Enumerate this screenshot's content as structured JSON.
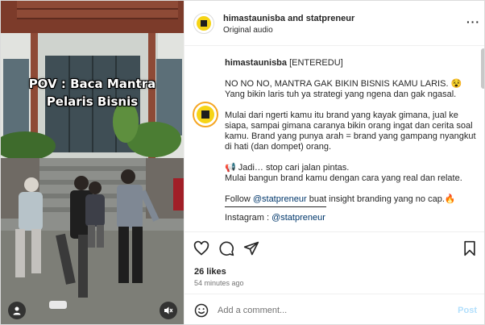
{
  "header": {
    "account_primary": "himastaunisba",
    "joiner": " and ",
    "account_secondary": "statpreneur",
    "audio": "Original audio",
    "more_icon": "more-horizontal-icon"
  },
  "media": {
    "caption_line1": "POV : Baca Mantra",
    "caption_line2": "Pelaris Bisnis",
    "user_icon": "user-tag-icon",
    "mute_icon": "muted-speaker-icon"
  },
  "post": {
    "author": "himastaunisba",
    "tag": "[ENTEREDU]",
    "line1": "NO NO NO, MANTRA GAK BIKIN BISNIS KAMU LARIS. 😵",
    "line2": "Yang bikin laris tuh ya strategi yang ngena dan gak ngasal.",
    "para2": "Mulai dari ngerti kamu itu brand yang kayak gimana, jual ke siapa, sampai gimana caranya bikin orang ingat dan cerita soal kamu. Brand yang punya arah = brand yang gampang nyangkut di hati (dan dompet) orang.",
    "para3_line1": "📢 Jadi… stop cari jalan pintas.",
    "para3_line2": "Mulai bangun brand kamu dengan cara yang real dan relate.",
    "follow_pre": "Follow ",
    "follow_mention": "@statpreneur",
    "follow_post": " buat insight branding yang no cap.🔥",
    "instagram_label": "Instagram : ",
    "instagram_mention": "@statpreneur"
  },
  "actions": {
    "like_icon": "heart-icon",
    "comment_icon": "comment-icon",
    "share_icon": "share-icon",
    "save_icon": "bookmark-icon"
  },
  "stats": {
    "likes": "26 likes",
    "time": "54 minutes ago"
  },
  "add_comment": {
    "placeholder": "Add a comment...",
    "post_label": "Post",
    "emoji_icon": "emoji-icon"
  },
  "colors": {
    "mention": "#00376b",
    "post_disabled": "#b2dffc",
    "muted_text": "#737373"
  }
}
